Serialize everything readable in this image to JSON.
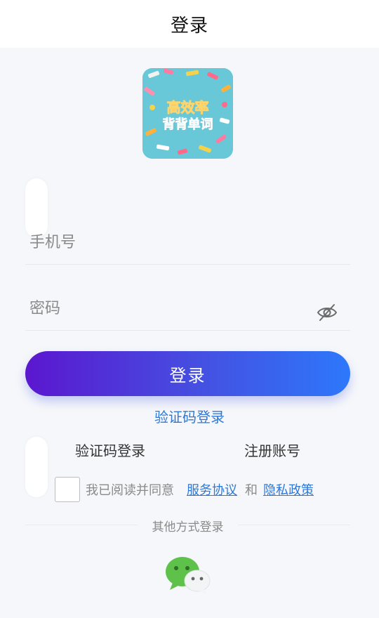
{
  "nav": {
    "title": "登录"
  },
  "logo": {
    "line1": "高效率",
    "line2": "背背单词"
  },
  "form": {
    "phone_placeholder": "手机号",
    "password_placeholder": "密码",
    "login_button": "登录",
    "code_login_link": "验证码登录"
  },
  "links": {
    "code_login": "验证码登录",
    "register": "注册账号"
  },
  "agreement": {
    "prefix": "我已阅读并同意",
    "service": "服务协议",
    "and": "和",
    "privacy": "隐私政策",
    "checked": false
  },
  "other": {
    "label": "其他方式登录"
  },
  "icons": {
    "password_toggle": "eye-off-icon",
    "wechat": "wechat-icon"
  },
  "colors": {
    "accent": "#2f78d8",
    "gradient_start": "#5b17cf",
    "gradient_end": "#2d78fb",
    "wechat": "#5ec24a"
  }
}
